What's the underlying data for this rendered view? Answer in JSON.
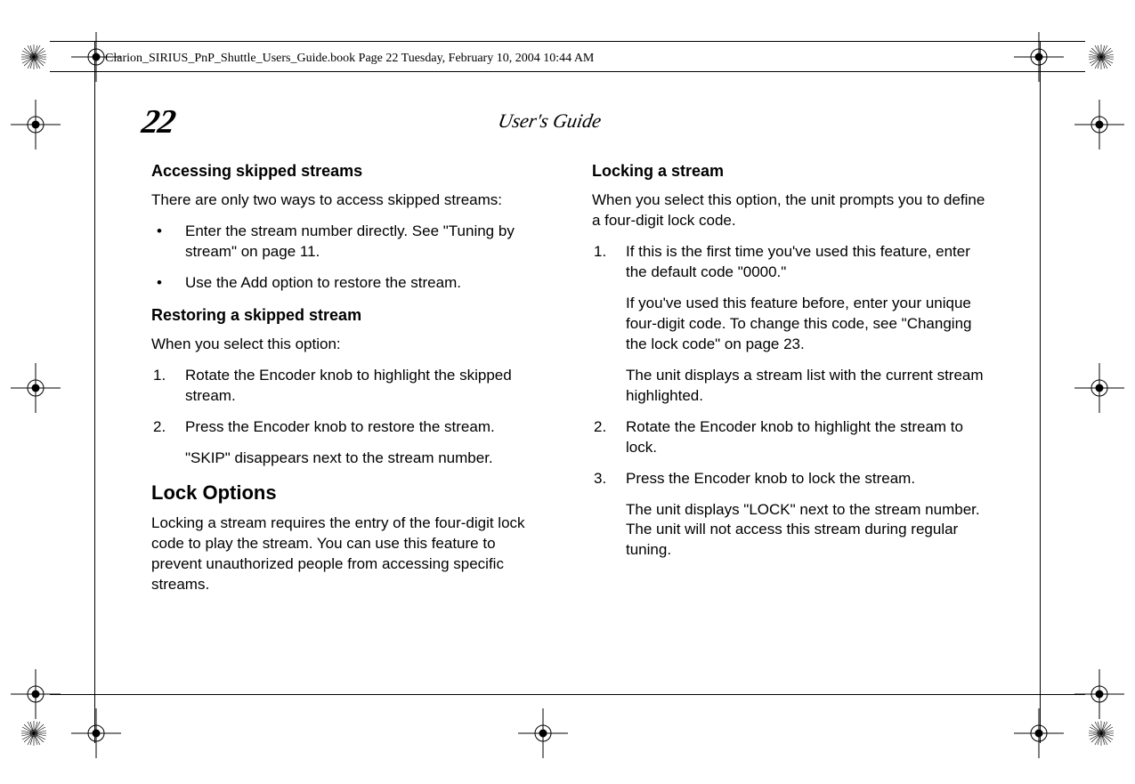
{
  "docheader": "Clarion_SIRIUS_PnP_Shuttle_Users_Guide.book  Page 22  Tuesday, February 10, 2004  10:44 AM",
  "page_number": "22",
  "running_head": "User's Guide",
  "left": {
    "h1": "Accessing skipped streams",
    "p1": "There are only two ways to access skipped streams:",
    "b1": "Enter the stream number directly. See \"Tuning by stream\" on page 11.",
    "b2": "Use the Add option to restore the stream.",
    "h2": "Restoring a skipped stream",
    "p2": "When you select this option:",
    "s1": "Rotate the Encoder knob to highlight the skipped stream.",
    "s2": "Press the Encoder knob to restore the stream.",
    "s2note": "\"SKIP\" disappears next to the stream number.",
    "h3": "Lock Options",
    "p3": "Locking a stream requires the entry of the four-digit lock code to play the stream. You can use this feature to prevent unauthorized people from accessing specific streams."
  },
  "right": {
    "h1": "Locking a stream",
    "p1": "When you select this option, the unit prompts you to define a four-digit lock code.",
    "s1": "If this is the first time you've used this feature, enter the default code \"0000.\"",
    "s1note1": "If you've used this feature before, enter your unique four-digit code. To change this code, see \"Changing the lock code\" on page 23.",
    "s1note2": "The unit displays a stream list with the current stream highlighted.",
    "s2": "Rotate the Encoder knob to highlight the stream to lock.",
    "s3": "Press the Encoder knob to lock the stream.",
    "s3note": "The unit displays \"LOCK\" next to the stream number. The unit will not access this stream during regular tuning."
  }
}
